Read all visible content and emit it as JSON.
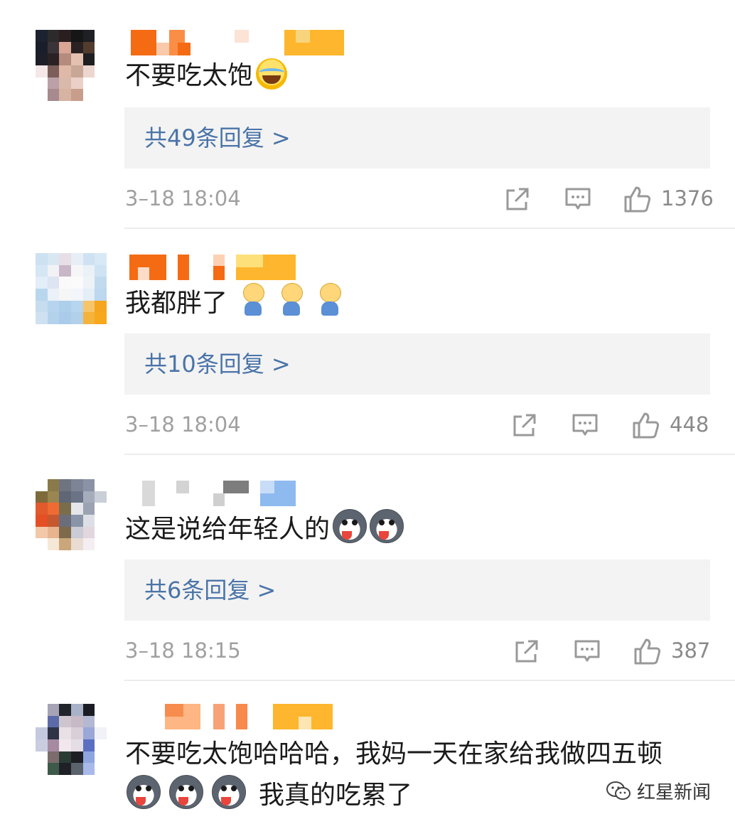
{
  "comments": [
    {
      "text": "不要吃太饱",
      "replies": "共49条回复 >",
      "time": "3–18 18:04",
      "likes": "1376"
    },
    {
      "text": "我都胖了",
      "replies": "共10条回复 >",
      "time": "3–18 18:04",
      "likes": "448"
    },
    {
      "text": "这是说给年轻人的",
      "replies": "共6条回复 >",
      "time": "3–18 18:15",
      "likes": "387"
    },
    {
      "text_line1": "不要吃太饱哈哈哈，我妈一天在家给我做四五顿",
      "text_line2": "我真的吃累了"
    }
  ],
  "watermark": "红星新闻",
  "icons": [
    "share-icon",
    "comment-icon",
    "like-icon",
    "wechat-icon"
  ],
  "colors": {
    "reply_link": "#4a74a8",
    "reply_bg": "#f3f3f3",
    "meta": "#a0a0a0"
  }
}
